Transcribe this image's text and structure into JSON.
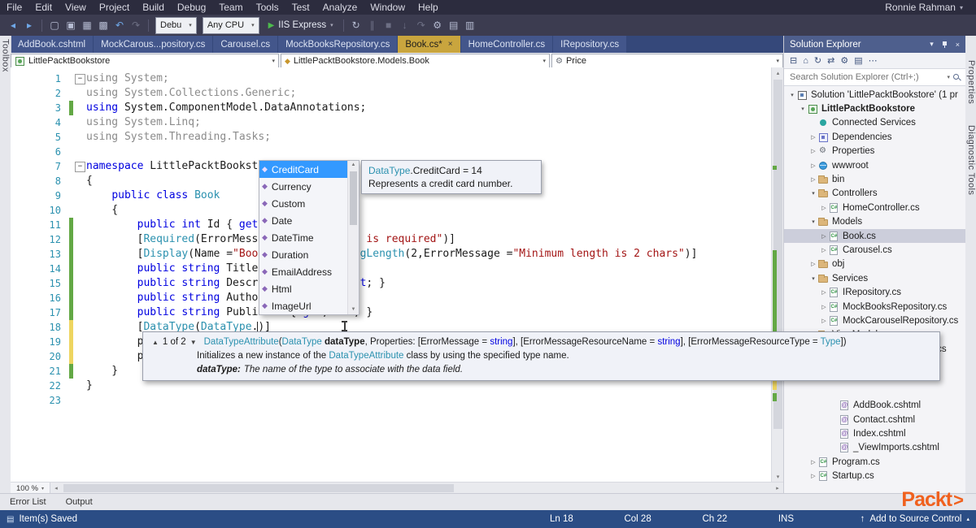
{
  "window": {
    "user": "Ronnie Rahman"
  },
  "menubar": {
    "items": [
      "File",
      "Edit",
      "View",
      "Project",
      "Build",
      "Debug",
      "Team",
      "Tools",
      "Test",
      "Analyze",
      "Window",
      "Help"
    ]
  },
  "toolbar": {
    "icons_a": [
      {
        "name": "nav-backward-icon",
        "glyph": "◂",
        "c": "blue"
      },
      {
        "name": "nav-forward-icon",
        "glyph": "▸",
        "c": "blue"
      }
    ],
    "icons_b": [
      {
        "name": "new-file-icon",
        "glyph": "▢"
      },
      {
        "name": "open-file-icon",
        "glyph": "▣"
      },
      {
        "name": "save-icon",
        "glyph": "▦"
      },
      {
        "name": "save-all-icon",
        "glyph": "▩"
      },
      {
        "name": "undo-icon",
        "glyph": "↶",
        "c": "blue"
      },
      {
        "name": "redo-icon",
        "glyph": "↷",
        "muted": true
      }
    ],
    "debug_combo": "Debu",
    "platform_combo": "Any CPU",
    "run_label": "IIS Express",
    "icons_c": [
      {
        "name": "refresh-icon",
        "glyph": "↻"
      },
      {
        "name": "break-all-icon",
        "glyph": "∥",
        "muted": true
      },
      {
        "name": "stop-debugging-icon",
        "glyph": "■",
        "muted": true
      },
      {
        "name": "step-into-icon",
        "glyph": "↓",
        "muted": true
      },
      {
        "name": "step-over-icon",
        "glyph": "↷",
        "muted": true
      },
      {
        "name": "solution-platforms-icon",
        "glyph": "⚙"
      },
      {
        "name": "comment-out-icon",
        "glyph": "▤"
      },
      {
        "name": "uncomment-icon",
        "glyph": "▥"
      }
    ]
  },
  "tabs": [
    {
      "label": "AddBook.cshtml",
      "active": false
    },
    {
      "label": "MockCarous...pository.cs",
      "active": false
    },
    {
      "label": "Carousel.cs",
      "active": false
    },
    {
      "label": "MockBooksRepository.cs",
      "active": false
    },
    {
      "label": "Book.cs*",
      "active": true
    },
    {
      "label": "HomeController.cs",
      "active": false
    },
    {
      "label": "IRepository.cs",
      "active": false
    }
  ],
  "breadcrumb": {
    "project": "LittlePacktBookstore",
    "type": "LittlePacktBookstore.Models.Book",
    "member": "Price"
  },
  "editor": {
    "zoom": "100 %",
    "lines": [
      {
        "n": 1,
        "fold": true,
        "segs": [
          [
            "g",
            "using System;"
          ]
        ]
      },
      {
        "n": 2,
        "segs": [
          [
            "g",
            "using System.Collections.Generic;"
          ]
        ]
      },
      {
        "n": 3,
        "mark": "green",
        "segs": [
          [
            "k",
            "using"
          ],
          [
            "p",
            " System.ComponentModel.DataAnnotations;"
          ]
        ]
      },
      {
        "n": 4,
        "segs": [
          [
            "g",
            "using System.Linq;"
          ]
        ]
      },
      {
        "n": 5,
        "segs": [
          [
            "g",
            "using System.Threading.Tasks;"
          ]
        ]
      },
      {
        "n": 6,
        "segs": []
      },
      {
        "n": 7,
        "fold": true,
        "segs": [
          [
            "k",
            "namespace"
          ],
          [
            "p",
            " LittlePacktBookstore.Models"
          ]
        ]
      },
      {
        "n": 8,
        "segs": [
          [
            "p",
            "{"
          ]
        ]
      },
      {
        "n": 9,
        "segs": [
          [
            "p",
            "    "
          ],
          [
            "k",
            "public"
          ],
          [
            "p",
            " "
          ],
          [
            "k",
            "class"
          ],
          [
            "p",
            " "
          ],
          [
            "t",
            "Book"
          ]
        ]
      },
      {
        "n": 10,
        "segs": [
          [
            "p",
            "    {"
          ]
        ]
      },
      {
        "n": 11,
        "mark": "green",
        "segs": [
          [
            "p",
            "        "
          ],
          [
            "k",
            "public"
          ],
          [
            "p",
            " "
          ],
          [
            "k",
            "int"
          ],
          [
            "p",
            " Id { "
          ],
          [
            "k",
            "get"
          ],
          [
            "p",
            "; "
          ],
          [
            "k",
            "set"
          ],
          [
            "p",
            "; }"
          ]
        ]
      },
      {
        "n": 12,
        "mark": "green",
        "segs": [
          [
            "p",
            "        ["
          ],
          [
            "t",
            "Required"
          ],
          [
            "p",
            "(ErrorMessage ="
          ],
          [
            "s",
            "\"Book Title is required\""
          ],
          [
            "p",
            ")]"
          ]
        ]
      },
      {
        "n": 13,
        "mark": "green",
        "segs": [
          [
            "p",
            "        ["
          ],
          [
            "t",
            "Display"
          ],
          [
            "p",
            "(Name ="
          ],
          [
            "s",
            "\"Book Title\""
          ],
          [
            "p",
            "), "
          ],
          [
            "t",
            "StringLength"
          ],
          [
            "p",
            "(2,ErrorMessage ="
          ],
          [
            "s",
            "\"Minimum length is 2 chars\""
          ],
          [
            "p",
            ")]"
          ]
        ]
      },
      {
        "n": 14,
        "mark": "green",
        "segs": [
          [
            "p",
            "        "
          ],
          [
            "k",
            "public"
          ],
          [
            "p",
            " "
          ],
          [
            "k",
            "string"
          ],
          [
            "p",
            " Title { "
          ],
          [
            "k",
            "get"
          ],
          [
            "p",
            "; "
          ],
          [
            "k",
            "set"
          ],
          [
            "p",
            "; }"
          ]
        ]
      },
      {
        "n": 15,
        "mark": "green",
        "segs": [
          [
            "p",
            "        "
          ],
          [
            "k",
            "public"
          ],
          [
            "p",
            " "
          ],
          [
            "k",
            "string"
          ],
          [
            "p",
            " Description { "
          ],
          [
            "k",
            "get"
          ],
          [
            "p",
            "; "
          ],
          [
            "k",
            "set"
          ],
          [
            "p",
            "; }"
          ]
        ]
      },
      {
        "n": 16,
        "mark": "green",
        "segs": [
          [
            "p",
            "        "
          ],
          [
            "k",
            "public"
          ],
          [
            "p",
            " "
          ],
          [
            "k",
            "string"
          ],
          [
            "p",
            " Author { "
          ],
          [
            "k",
            "get"
          ],
          [
            "p",
            "; "
          ],
          [
            "k",
            "set"
          ],
          [
            "p",
            "; }"
          ]
        ]
      },
      {
        "n": 17,
        "mark": "green",
        "segs": [
          [
            "p",
            "        "
          ],
          [
            "k",
            "public"
          ],
          [
            "p",
            " "
          ],
          [
            "k",
            "string"
          ],
          [
            "p",
            " Publisher { "
          ],
          [
            "k",
            "get"
          ],
          [
            "p",
            "; "
          ],
          [
            "k",
            "set"
          ],
          [
            "p",
            "; }"
          ]
        ]
      },
      {
        "n": 18,
        "mark": "yellow",
        "segs": [
          [
            "p",
            "        ["
          ],
          [
            "t",
            "DataType"
          ],
          [
            "p",
            "("
          ],
          [
            "t",
            "DataType"
          ],
          [
            "p",
            "."
          ],
          [
            "c",
            ""
          ],
          [
            "p",
            ")]"
          ]
        ]
      },
      {
        "n": 19,
        "mark": "yellow",
        "segs": [
          [
            "p",
            "        p"
          ]
        ]
      },
      {
        "n": 20,
        "mark": "yellow",
        "segs": [
          [
            "p",
            "        p"
          ]
        ]
      },
      {
        "n": 21,
        "mark": "green",
        "segs": [
          [
            "p",
            "    }"
          ]
        ]
      },
      {
        "n": 22,
        "segs": [
          [
            "p",
            "}"
          ]
        ]
      },
      {
        "n": 23,
        "segs": []
      }
    ]
  },
  "intellisense": {
    "items": [
      {
        "label": "CreditCard",
        "selected": true
      },
      {
        "label": "Currency"
      },
      {
        "label": "Custom"
      },
      {
        "label": "Date"
      },
      {
        "label": "DateTime"
      },
      {
        "label": "Duration"
      },
      {
        "label": "EmailAddress"
      },
      {
        "label": "Html"
      },
      {
        "label": "ImageUrl"
      }
    ],
    "tooltip": {
      "title_type": "DataType",
      "title_rest": ".CreditCard = 14",
      "description": "Represents a credit card number."
    }
  },
  "signature_help": {
    "pager": "1 of 2",
    "sig_parts": [
      [
        "t",
        "DataTypeAttribute"
      ],
      [
        "p",
        "("
      ],
      [
        "t",
        "DataType"
      ],
      [
        "b",
        " dataType"
      ],
      [
        "p",
        ", Properties: [ErrorMessage = "
      ],
      [
        "k",
        "string"
      ],
      [
        "p",
        "], [ErrorMessageResourceName = "
      ],
      [
        "k",
        "string"
      ],
      [
        "p",
        "], [ErrorMessageResourceType = "
      ],
      [
        "t",
        "Type"
      ],
      [
        "p",
        "])"
      ]
    ],
    "summary_parts": [
      [
        "p",
        "Initializes a new instance of the "
      ],
      [
        "t",
        "DataTypeAttribute"
      ],
      [
        "p",
        " class by using the specified type name."
      ]
    ],
    "param_label": "dataType:",
    "param_desc": "The name of the type to associate with the data field."
  },
  "solution_explorer": {
    "title": "Solution Explorer",
    "search_placeholder": "Search Solution Explorer (Ctrl+;)",
    "toolbar_icons": [
      {
        "name": "collapse-all-icon",
        "glyph": "⊟"
      },
      {
        "name": "home-icon",
        "glyph": "⌂"
      },
      {
        "name": "refresh-icon",
        "glyph": "↻"
      },
      {
        "name": "sync-with-active-document-icon",
        "glyph": "⇄"
      },
      {
        "name": "properties-icon",
        "glyph": "⚙"
      },
      {
        "name": "show-all-files-icon",
        "glyph": "▤"
      },
      {
        "name": "more-options-icon",
        "glyph": "⋯"
      }
    ],
    "tree": [
      {
        "label": "Solution 'LittlePacktBookstore' (1 pr",
        "level": 0,
        "icon": "solution",
        "arrow": "down"
      },
      {
        "label": "LittlePacktBookstore",
        "level": 1,
        "icon": "project",
        "arrow": "down",
        "bold": true
      },
      {
        "label": "Connected Services",
        "level": 2,
        "icon": "plug",
        "arrow": "none"
      },
      {
        "label": "Dependencies",
        "level": 2,
        "icon": "deps",
        "arrow": "right"
      },
      {
        "label": "Properties",
        "level": 2,
        "icon": "wrench",
        "arrow": "right"
      },
      {
        "label": "wwwroot",
        "level": 2,
        "icon": "globe",
        "arrow": "right"
      },
      {
        "label": "bin",
        "level": 2,
        "icon": "folder",
        "arrow": "right"
      },
      {
        "label": "Controllers",
        "level": 2,
        "icon": "folder",
        "arrow": "down"
      },
      {
        "label": "HomeController.cs",
        "level": 3,
        "icon": "cs",
        "arrow": "right"
      },
      {
        "label": "Models",
        "level": 2,
        "icon": "folder",
        "arrow": "down"
      },
      {
        "label": "Book.cs",
        "level": 3,
        "icon": "cs",
        "arrow": "right",
        "selected": true
      },
      {
        "label": "Carousel.cs",
        "level": 3,
        "icon": "cs",
        "arrow": "right"
      },
      {
        "label": "obj",
        "level": 2,
        "icon": "folder",
        "arrow": "right"
      },
      {
        "label": "Services",
        "level": 2,
        "icon": "folder",
        "arrow": "down"
      },
      {
        "label": "IRepository.cs",
        "level": 3,
        "icon": "cs",
        "arrow": "right"
      },
      {
        "label": "MockBooksRepository.cs",
        "level": 3,
        "icon": "cs",
        "arrow": "right"
      },
      {
        "label": "MockCarouselRepository.cs",
        "level": 3,
        "icon": "cs",
        "arrow": "right"
      },
      {
        "label": "ViewModels",
        "level": 2,
        "icon": "folder",
        "arrow": "down"
      },
      {
        "label": "el.cs",
        "level": 3,
        "icon": "none",
        "arrow": "none",
        "fragment": true
      },
      {
        "label": "",
        "level": 3,
        "icon": "none",
        "arrow": "none"
      },
      {
        "label": "",
        "level": 3,
        "icon": "none",
        "arrow": "none"
      },
      {
        "label": "",
        "level": 3,
        "icon": "none",
        "arrow": "none"
      },
      {
        "label": "AddBook.cshtml",
        "level": 4,
        "icon": "razor",
        "arrow": "none"
      },
      {
        "label": "Contact.cshtml",
        "level": 4,
        "icon": "razor",
        "arrow": "none"
      },
      {
        "label": "Index.cshtml",
        "level": 4,
        "icon": "razor",
        "arrow": "none"
      },
      {
        "label": "_ViewImports.cshtml",
        "level": 4,
        "icon": "razor",
        "arrow": "none"
      },
      {
        "label": "Program.cs",
        "level": 2,
        "icon": "cs",
        "arrow": "right"
      },
      {
        "label": "Startup.cs",
        "level": 2,
        "icon": "cs",
        "arrow": "right"
      }
    ]
  },
  "bottom_panel": {
    "tabs": [
      "Error List",
      "Output"
    ],
    "logo": "Packt",
    "logo_mark": ">"
  },
  "statusbar": {
    "message": "Item(s) Saved",
    "ln": "Ln 18",
    "col": "Col 28",
    "ch": "Ch 22",
    "mode": "INS",
    "source_control": "Add to Source Control"
  },
  "side_strips": {
    "left": "Toolbox",
    "right_top": "Properties",
    "right_bottom": "Diagnostic Tools"
  }
}
